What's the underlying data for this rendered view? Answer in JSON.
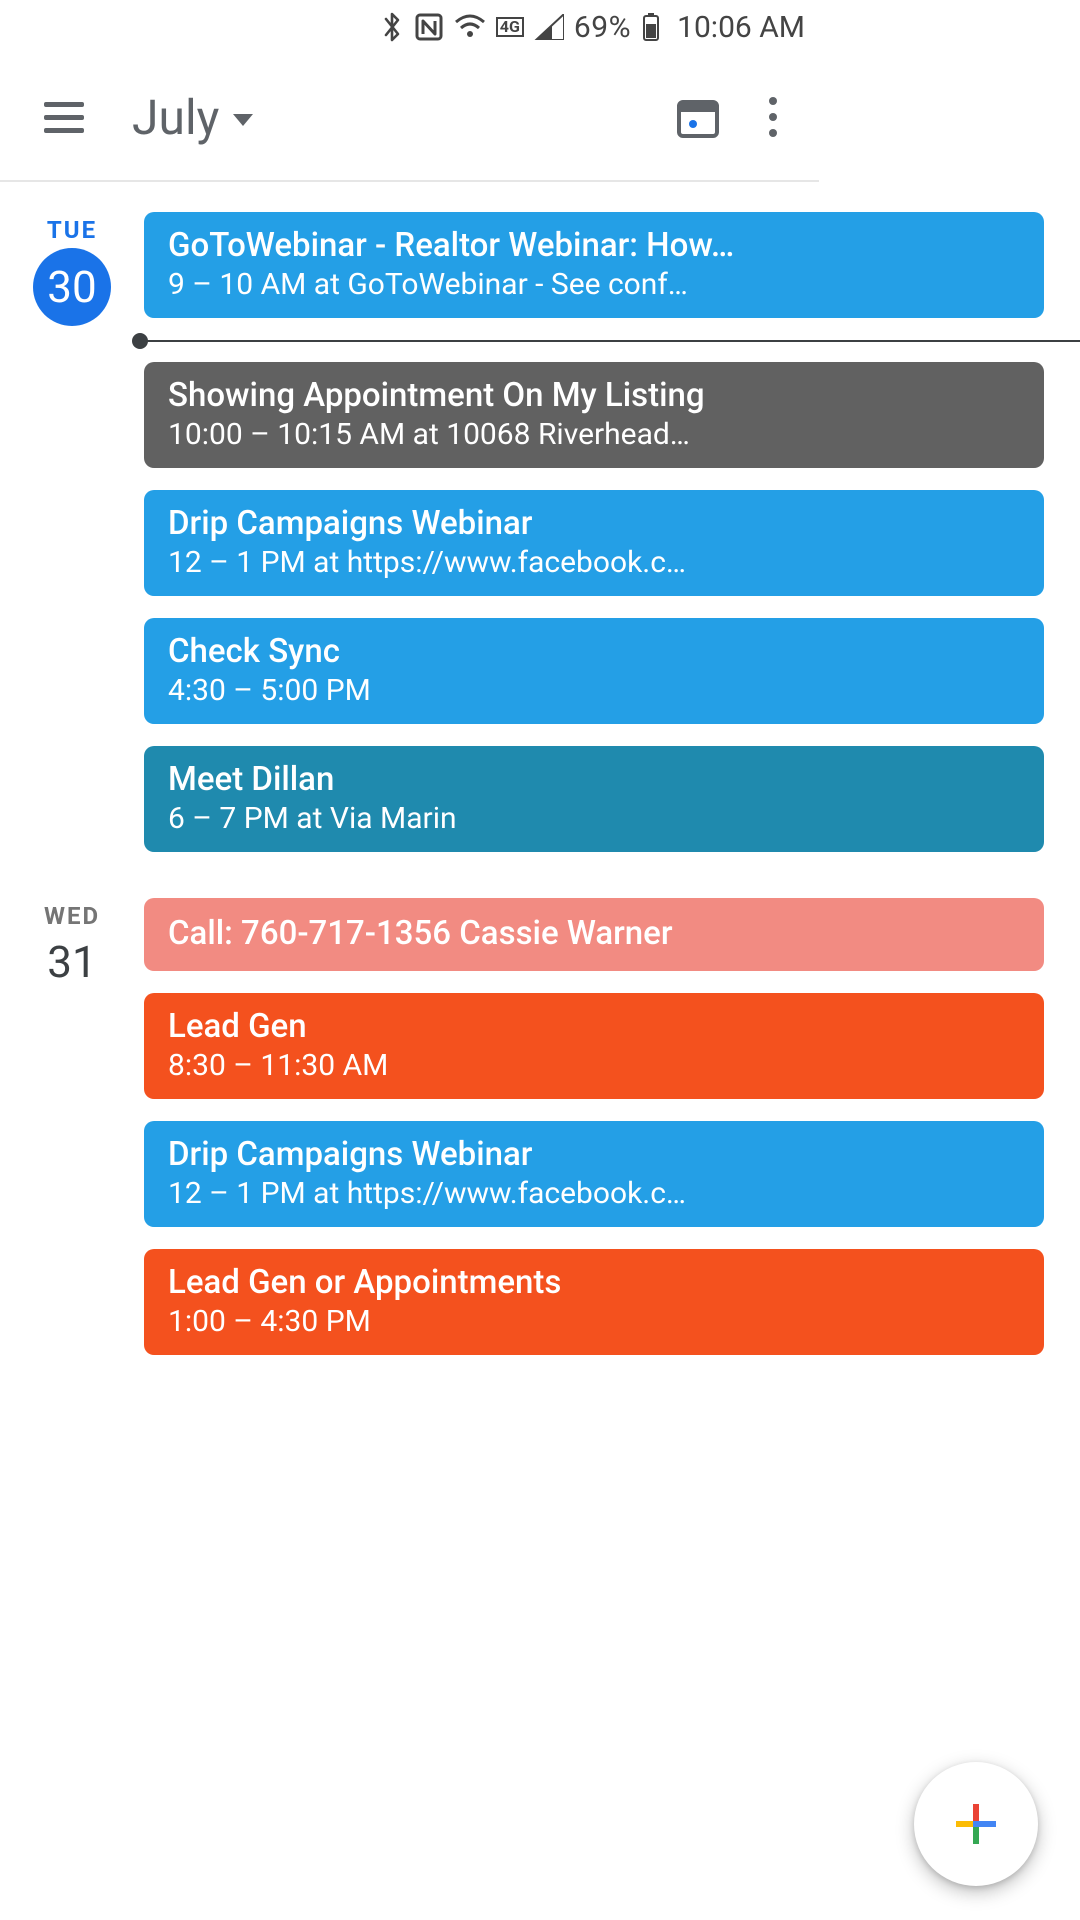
{
  "status": {
    "battery_pct": "69%",
    "clock": "10:06 AM",
    "network_label": "4G"
  },
  "header": {
    "month_label": "July"
  },
  "colors": {
    "blue": "#249fe6",
    "gray": "#616161",
    "teal": "#1f8aae",
    "salmon": "#f28b82",
    "orange": "#f4511e",
    "brand_blue": "#1a73e8"
  },
  "days": [
    {
      "dow": "TUE",
      "dnum": "30",
      "is_today": true,
      "now_after_index": 0,
      "events": [
        {
          "title": "GoToWebinar - Realtor Webinar: How…",
          "sub": "9 – 10 AM at GoToWebinar - See conf…",
          "color": "c-blue"
        },
        {
          "title": "Showing Appointment On My Listing",
          "sub": "10:00 – 10:15 AM at 10068 Riverhead…",
          "color": "c-gray"
        },
        {
          "title": "Drip Campaigns Webinar",
          "sub": "12 – 1 PM at https://www.facebook.c…",
          "color": "c-blue"
        },
        {
          "title": "Check Sync",
          "sub": "4:30 – 5:00 PM",
          "color": "c-blue"
        },
        {
          "title": "Meet Dillan",
          "sub": "6 – 7 PM at Via Marin",
          "color": "c-teal"
        }
      ]
    },
    {
      "dow": "WED",
      "dnum": "31",
      "is_today": false,
      "events": [
        {
          "title": "Call: 760-717-1356 Cassie Warner",
          "sub": "",
          "color": "c-salmon",
          "single": true
        },
        {
          "title": "Lead Gen",
          "sub": "8:30 – 11:30 AM",
          "color": "c-orange"
        },
        {
          "title": "Drip Campaigns Webinar",
          "sub": "12 – 1 PM at https://www.facebook.c…",
          "color": "c-blue"
        },
        {
          "title": "Lead Gen or Appointments",
          "sub": "1:00 – 4:30 PM",
          "color": "c-orange"
        }
      ]
    }
  ]
}
